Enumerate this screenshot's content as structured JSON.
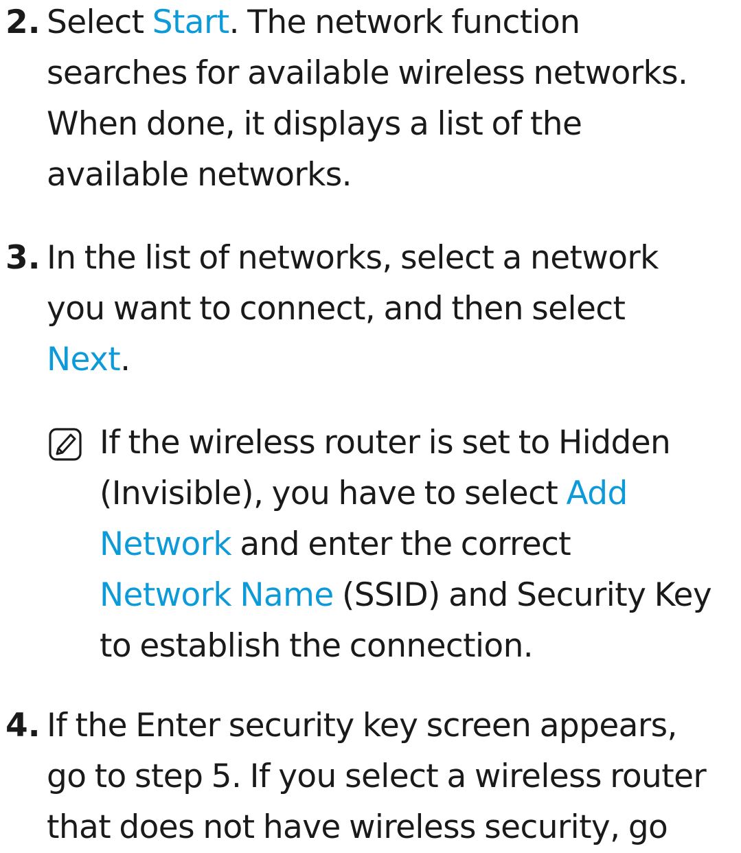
{
  "colors": {
    "text": "#1a1a1a",
    "link": "#0d9ad8",
    "background": "#ffffff"
  },
  "steps": [
    {
      "number": "2.",
      "line1_pre": "Select ",
      "link1": "Start",
      "line1_post": ". The network function",
      "line2": "searches for available wireless networks.",
      "line3": "When done, it displays a list of the",
      "line4": "available networks."
    },
    {
      "number": "3.",
      "line1": "In the list of networks, select a network",
      "line2": "you want to connect, and then select",
      "link1": "Next",
      "line3_post": "."
    },
    {
      "number": "4.",
      "line1": "If the Enter security key screen appears,",
      "line2": "go to step 5. If you select a wireless router",
      "line3": "that does not have wireless security, go"
    }
  ],
  "note": {
    "icon": "note-pencil-icon",
    "line1": "If the wireless router is set to Hidden",
    "line2_pre": "(Invisible), you have to select ",
    "link1a": "Add",
    "link1b": "Network",
    "line3_post": " and enter the correct",
    "link2": "Network Name",
    "line4_post": " (SSID) and Security Key",
    "line5": "to establish the connection."
  }
}
